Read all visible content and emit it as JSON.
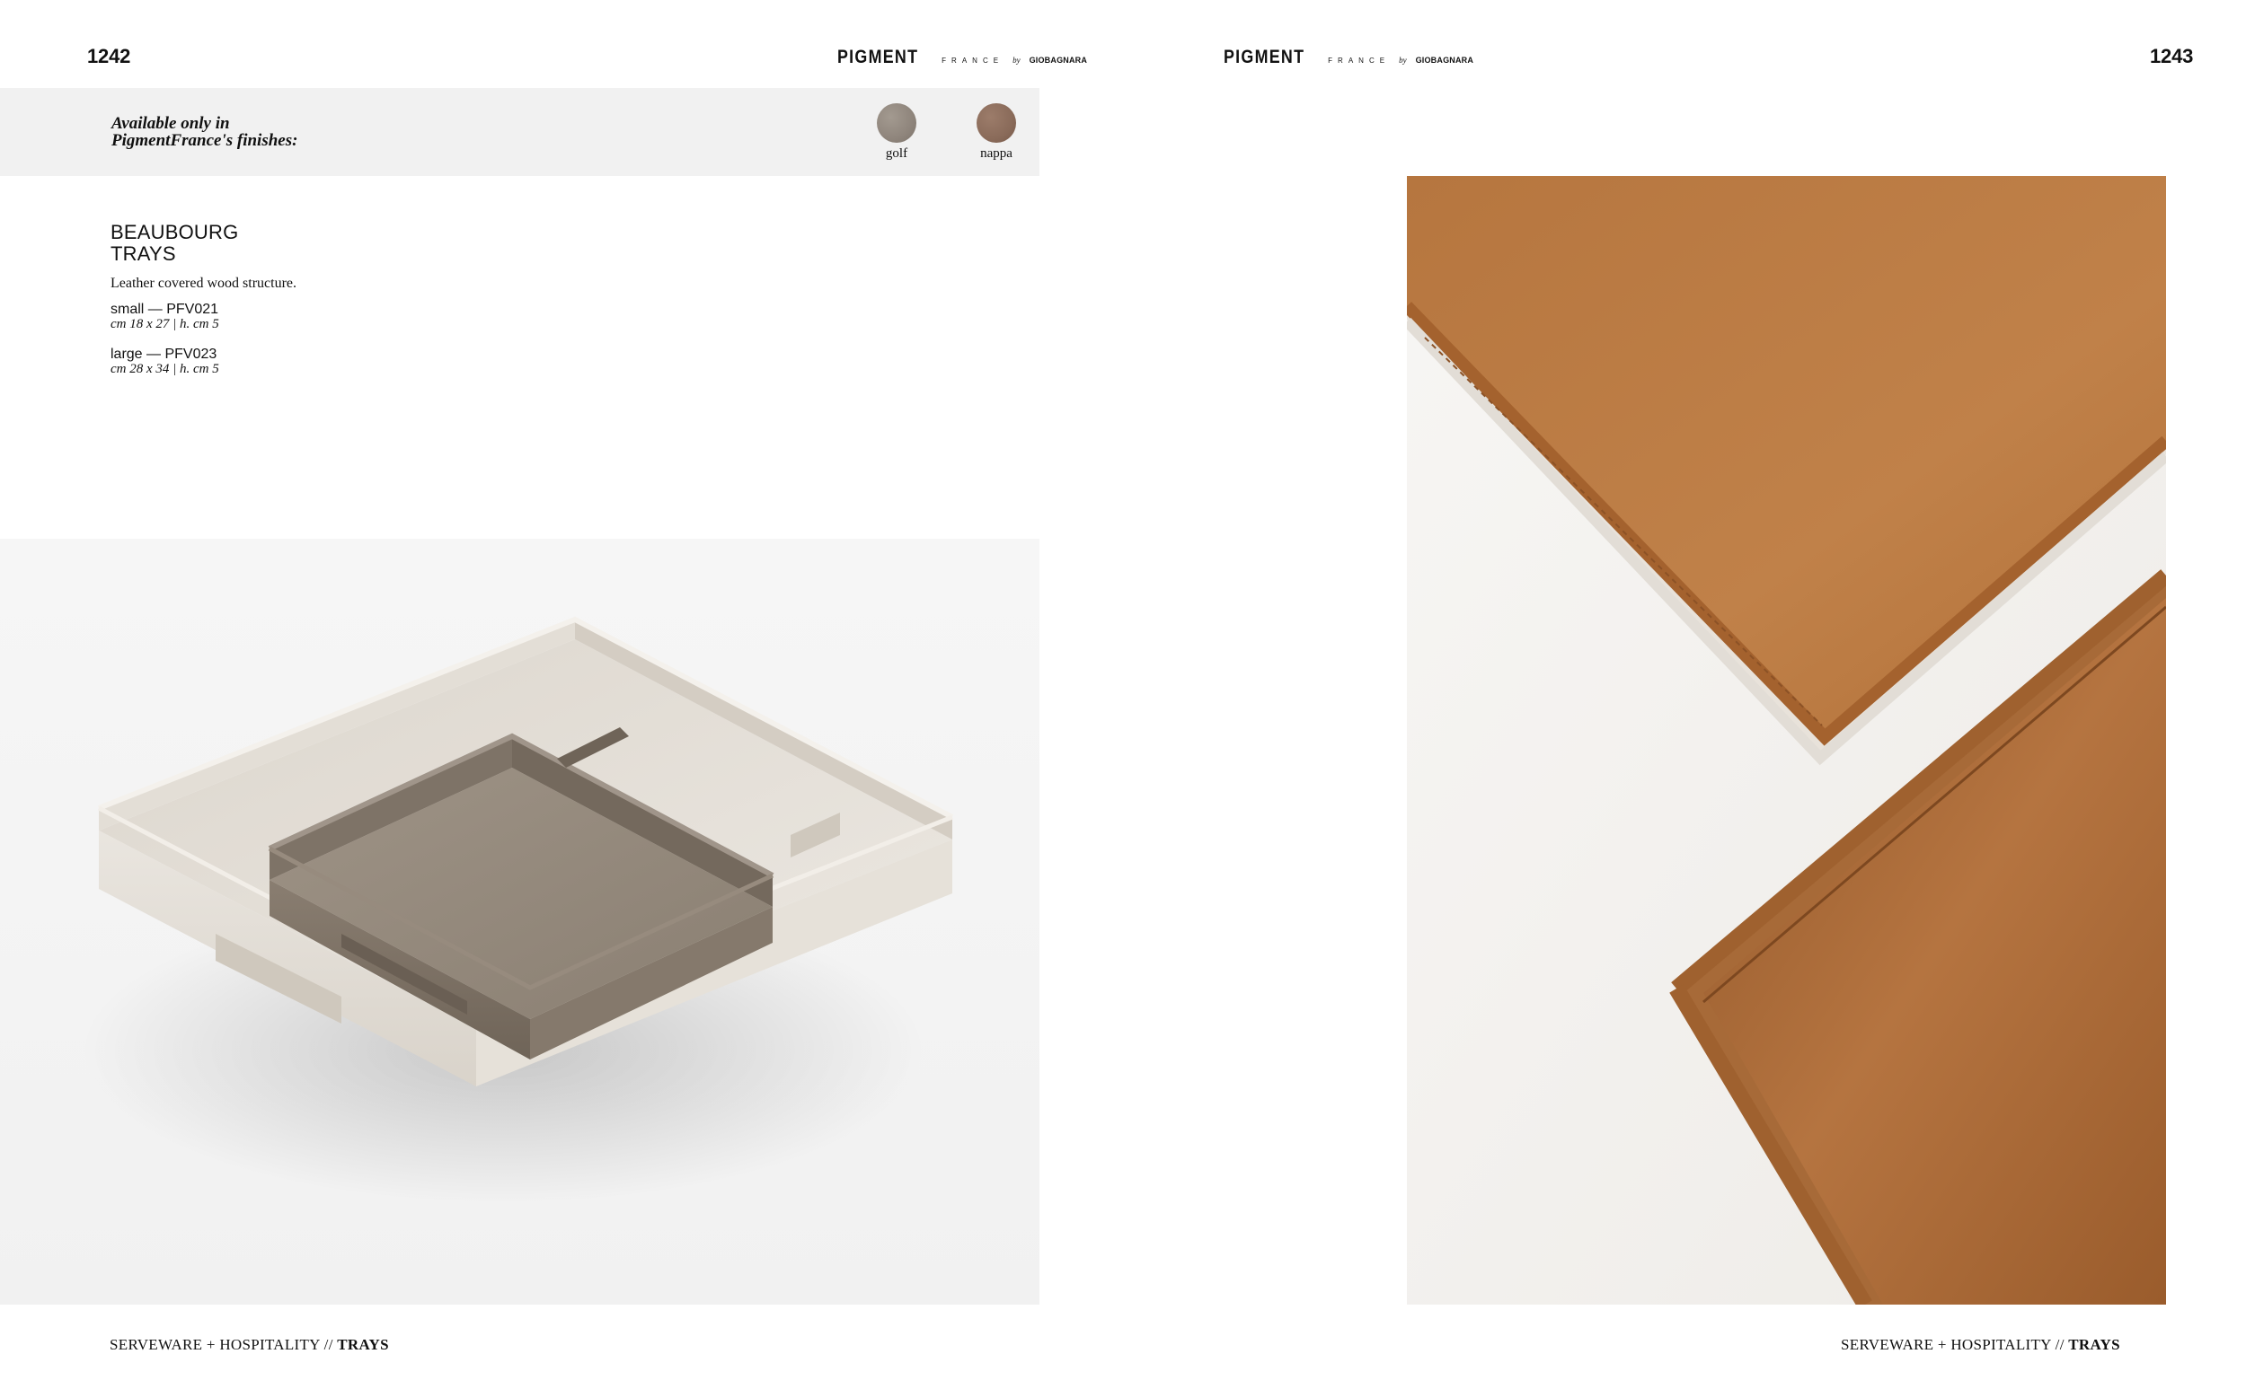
{
  "header": {
    "left_page_number": "1242",
    "right_page_number": "1243",
    "brand": {
      "name": "PIGMENT",
      "sub": "FRANCE",
      "by": "by",
      "maker": "GIOBAGNARA"
    }
  },
  "finishes": {
    "title_line1": "Available only in",
    "title_line2": "PigmentFrance's finishes:",
    "swatches": [
      {
        "label": "golf",
        "color": "#8f857c"
      },
      {
        "label": "nappa",
        "color": "#8a6b5a"
      }
    ]
  },
  "product": {
    "title_line1": "BEAUBOURG",
    "title_line2": "TRAYS",
    "description": "Leather covered wood structure.",
    "variants": [
      {
        "name": "small — PFV021",
        "dimensions": "cm 18 x 27 | h. cm 5"
      },
      {
        "name": "large — PFV023",
        "dimensions": "cm 28 x 34 | h. cm 5"
      }
    ]
  },
  "footer": {
    "section": "SERVEWARE + HOSPITALITY //",
    "category": "TRAYS"
  },
  "colors": {
    "band_background": "#f1f1f1",
    "tray_beige": "#e7e2da",
    "tray_taupe": "#8b7f72",
    "tray_cognac": "#b7763f"
  }
}
